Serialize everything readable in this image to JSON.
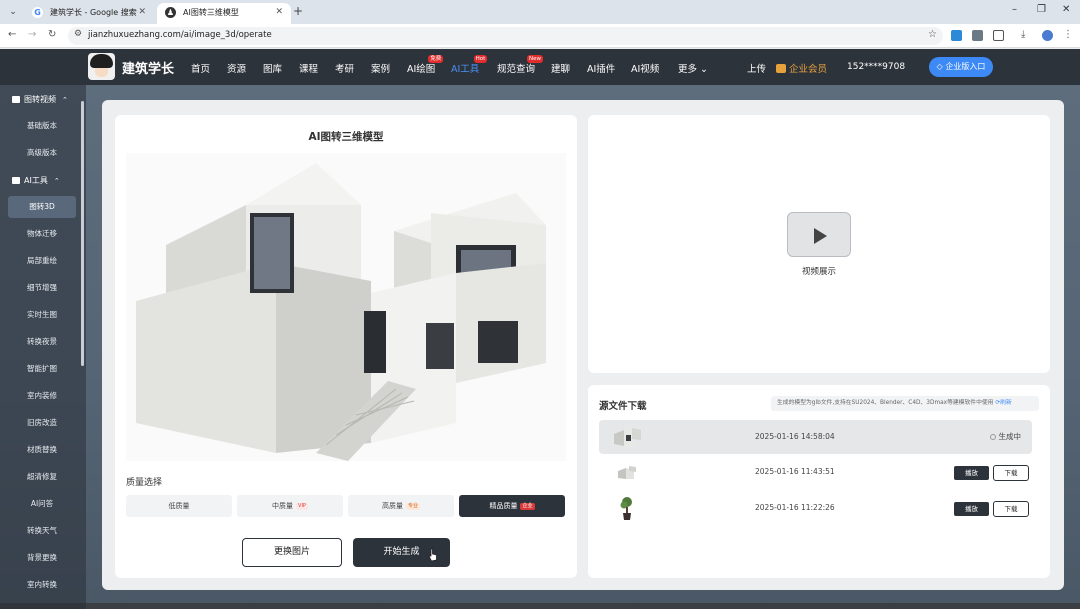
{
  "browser": {
    "tabs": [
      {
        "title": "建筑学长 - Google 搜索",
        "icon": "google-icon"
      },
      {
        "title": "AI图转三维模型",
        "icon": "site-favicon"
      }
    ],
    "url": "jianzhuxuezhang.com/ai/image_3d/operate"
  },
  "header": {
    "logo_text": "建筑学长",
    "nav": [
      {
        "label": "首页"
      },
      {
        "label": "资源"
      },
      {
        "label": "图库"
      },
      {
        "label": "课程"
      },
      {
        "label": "考研"
      },
      {
        "label": "案例"
      },
      {
        "label": "AI绘图",
        "badge": "免费"
      },
      {
        "label": "AI工具",
        "badge": "Hot",
        "active": true
      },
      {
        "label": "规范查询",
        "badge": "New"
      },
      {
        "label": "建聊"
      },
      {
        "label": "AI插件"
      },
      {
        "label": "AI视频"
      },
      {
        "label": "更多"
      }
    ],
    "upload": "上传",
    "vip": "企业会员",
    "phone": "152****9708",
    "enterprise_button": "企业版入口",
    "colors": {
      "bar": "#2d333b",
      "accent": "#3d8af7",
      "vip": "#e8a23c"
    }
  },
  "sidebar": {
    "groups": [
      {
        "label": "图转视频",
        "items": [
          "基础版本",
          "高级版本"
        ]
      },
      {
        "label": "AI工具",
        "items": [
          "图转3D",
          "物体迁移",
          "局部重绘",
          "细节增强",
          "实时生图",
          "转换夜景",
          "智能扩图",
          "室内装修",
          "旧房改造",
          "材质替换",
          "超清修复",
          "AI问答",
          "转换天气",
          "背景更换",
          "室内转换"
        ]
      }
    ],
    "active_item": "图转3D"
  },
  "left_panel": {
    "title": "AI图转三维模型",
    "quality_label": "质量选择",
    "quality_options": [
      {
        "label": "低质量",
        "tag": ""
      },
      {
        "label": "中质量",
        "tag": "VIP"
      },
      {
        "label": "高质量",
        "tag": "专业"
      },
      {
        "label": "精品质量",
        "tag": "企业",
        "selected": true
      }
    ],
    "change_button": "更换图片",
    "start_button": "开始生成"
  },
  "video_panel": {
    "label": "视频展示"
  },
  "files_panel": {
    "title": "源文件下载",
    "note": "生成的模型为glb文件,支持在SU2024、Blender、C4D、3Dmax等建模软件中使用",
    "refresh": "刷新",
    "rows": [
      {
        "time": "2025-01-16 14:58:04",
        "status": "生成中",
        "thumb": "house-model-thumbnail"
      },
      {
        "time": "2025-01-16 11:43:51",
        "play": "播放",
        "download": "下载",
        "thumb": "small-house-thumbnail"
      },
      {
        "time": "2025-01-16 11:22:26",
        "play": "播放",
        "download": "下载",
        "thumb": "potted-plant-thumbnail"
      }
    ]
  }
}
